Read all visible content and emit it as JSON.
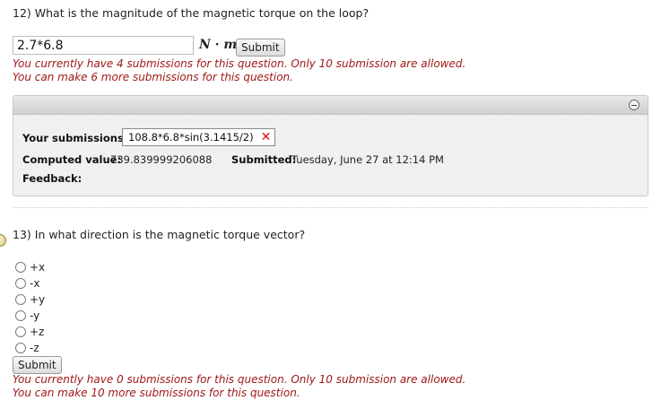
{
  "q12": {
    "prompt": "12) What is the magnitude of the magnetic torque on the loop?",
    "answer_value": "2.7*6.8",
    "units": "N · m",
    "submit_label": "Submit",
    "warning_line1": "You currently have 4 submissions for this question. Only 10 submission are allowed.",
    "warning_line2": "You can make 6 more submissions for this question."
  },
  "submissions_panel": {
    "your_submissions_label": "Your submissions:",
    "submission_text": "108.8*6.8*sin(3.1415/2)",
    "computed_label": "Computed value:",
    "computed_value": "739.839999206088",
    "submitted_label": "Submitted:",
    "submitted_value": "Tuesday, June 27 at 12:14 PM",
    "feedback_label": "Feedback:",
    "status_icon": "x-icon",
    "collapse_icon": "minus-circle-icon"
  },
  "q13": {
    "prompt": "13) In what direction is the magnetic torque vector?",
    "options": [
      "+x",
      "-x",
      "+y",
      "-y",
      "+z",
      "-z"
    ],
    "submit_label": "Submit",
    "warning_line1": "You currently have 0 submissions for this question. Only 10 submission are allowed.",
    "warning_line2": "You can make 10 more submissions for this question."
  }
}
